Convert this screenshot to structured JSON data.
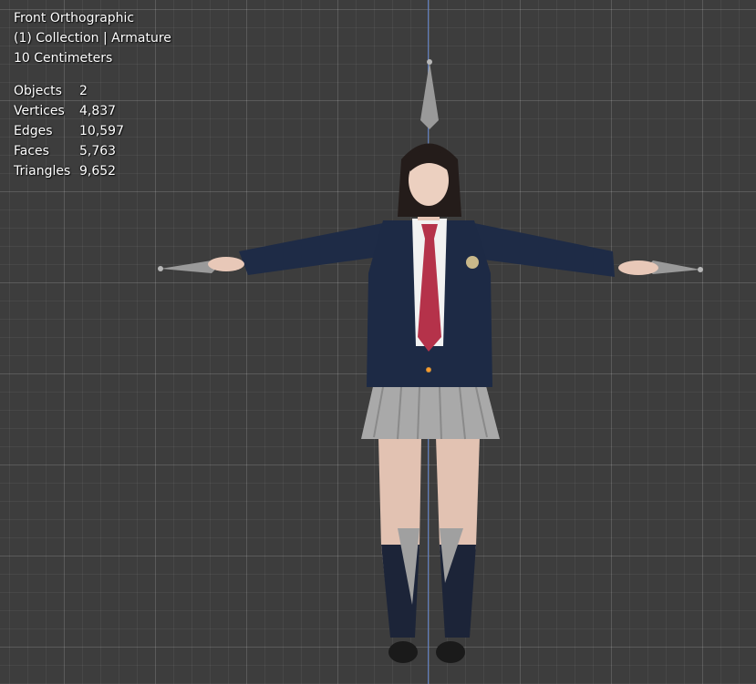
{
  "viewport": {
    "view_name": "Front Orthographic",
    "collection_line": "(1) Collection | Armature",
    "grid_scale": "10 Centimeters"
  },
  "stats": {
    "objects": {
      "label": "Objects",
      "value": "2"
    },
    "vertices": {
      "label": "Vertices",
      "value": "4,837"
    },
    "edges": {
      "label": "Edges",
      "value": "10,597"
    },
    "faces": {
      "label": "Faces",
      "value": "5,763"
    },
    "triangles": {
      "label": "Triangles",
      "value": "9,652"
    }
  },
  "colors": {
    "background": "#3d3d3d",
    "axis": "#5a7bc0",
    "bone": "#9a9a9a",
    "jacket": "#1d2a45",
    "tie": "#b5324a",
    "skirt": "#a8a8a8"
  }
}
